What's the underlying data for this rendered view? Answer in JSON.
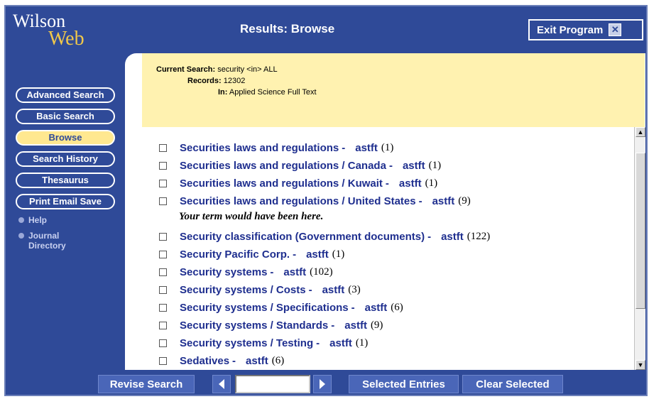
{
  "app": {
    "logo_top": "Wilson",
    "logo_bottom": "Web",
    "title": "Results: Browse",
    "exit_label": "Exit Program",
    "exit_icon": "close-icon"
  },
  "sidebar": {
    "buttons": [
      {
        "label": "Advanced Search",
        "active": false
      },
      {
        "label": "Basic Search",
        "active": false
      },
      {
        "label": "Browse",
        "active": true
      },
      {
        "label": "Search History",
        "active": false
      },
      {
        "label": "Thesaurus",
        "active": false
      },
      {
        "label": "Print Email Save",
        "active": false
      }
    ],
    "links": [
      {
        "label": "Help"
      },
      {
        "label": "Journal Directory",
        "line1": "Journal",
        "line2": "Directory"
      }
    ]
  },
  "search_info": {
    "current_search_label": "Current Search:",
    "current_search_value": "security <in> ALL",
    "records_label": "Records:",
    "records_value": "12302",
    "in_label": "In:",
    "in_value": "Applied Science Full Text"
  },
  "results": [
    {
      "term": "Securities laws and regulations",
      "db": "astft",
      "count": "(1)"
    },
    {
      "term": "Securities laws and regulations / Canada",
      "db": "astft",
      "count": "(1)"
    },
    {
      "term": "Securities laws and regulations / Kuwait",
      "db": "astft",
      "count": "(1)"
    },
    {
      "term": "Securities laws and regulations / United States",
      "db": "astft",
      "count": "(9)"
    },
    {
      "term": "Security classification (Government documents)",
      "db": "astft",
      "count": "(122)"
    },
    {
      "term": "Security Pacific Corp.",
      "db": "astft",
      "count": "(1)"
    },
    {
      "term": "Security systems",
      "db": "astft",
      "count": "(102)"
    },
    {
      "term": "Security systems / Costs",
      "db": "astft",
      "count": "(3)"
    },
    {
      "term": "Security systems / Specifications",
      "db": "astft",
      "count": "(6)"
    },
    {
      "term": "Security systems / Standards",
      "db": "astft",
      "count": "(9)"
    },
    {
      "term": "Security systems / Testing",
      "db": "astft",
      "count": "(1)"
    },
    {
      "term": "Sedatives",
      "db": "astft",
      "count": "(6)"
    }
  ],
  "placeholder_text": "Your term would have been here.",
  "separator": "-",
  "footer": {
    "revise_label": "Revise Search",
    "jump_value": "",
    "selected_label": "Selected Entries",
    "clear_label": "Clear Selected"
  },
  "colors": {
    "primary": "#2f4a98",
    "highlight": "#ffe890",
    "info_bg": "#fff2b0",
    "link": "#1f2f8f"
  }
}
